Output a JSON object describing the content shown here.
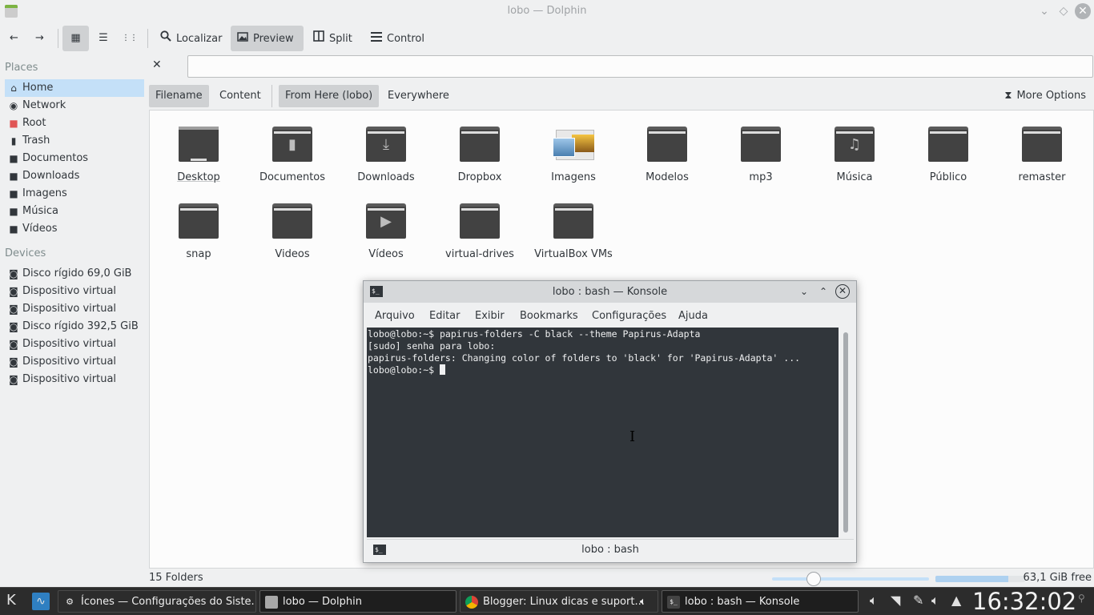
{
  "window": {
    "title": "lobo — Dolphin",
    "controls": {
      "minimize": "⌄",
      "maximize": "◇",
      "close": "✕"
    }
  },
  "toolbar": {
    "back_icon": "←",
    "forward_icon": "→",
    "view_icons": "▦",
    "view_compact": "☰",
    "view_details": "⋮⋮",
    "search_label": "Localizar",
    "preview_label": "Preview",
    "split_label": "Split",
    "control_label": "Control"
  },
  "sidebar": {
    "places_title": "Places",
    "places": [
      {
        "label": "Home",
        "icon": "home-icon"
      },
      {
        "label": "Network",
        "icon": "network-icon"
      },
      {
        "label": "Root",
        "icon": "folder-red-icon"
      },
      {
        "label": "Trash",
        "icon": "trash-icon"
      },
      {
        "label": "Documentos",
        "icon": "folder-icon"
      },
      {
        "label": "Downloads",
        "icon": "folder-icon"
      },
      {
        "label": "Imagens",
        "icon": "folder-icon"
      },
      {
        "label": "Música",
        "icon": "folder-icon"
      },
      {
        "label": "Vídeos",
        "icon": "folder-icon"
      }
    ],
    "devices_title": "Devices",
    "devices": [
      "Disco rígido 69,0 GiB",
      "Dispositivo virtual",
      "Dispositivo virtual",
      "Disco rígido 392,5 GiB",
      "Dispositivo virtual",
      "Dispositivo virtual",
      "Dispositivo virtual"
    ]
  },
  "search": {
    "close_icon": "✕",
    "value": "",
    "filters": {
      "filename": "Filename",
      "content": "Content",
      "from_here": "From Here (lobo)",
      "everywhere": "Everywhere",
      "more_options": "More Options"
    }
  },
  "files": [
    {
      "name": "Desktop",
      "type": "desktop"
    },
    {
      "name": "Documentos",
      "type": "documents"
    },
    {
      "name": "Downloads",
      "type": "downloads"
    },
    {
      "name": "Dropbox",
      "type": "folder"
    },
    {
      "name": "Imagens",
      "type": "images"
    },
    {
      "name": "Modelos",
      "type": "folder"
    },
    {
      "name": "mp3",
      "type": "folder"
    },
    {
      "name": "Música",
      "type": "music"
    },
    {
      "name": "Público",
      "type": "folder"
    },
    {
      "name": "remaster",
      "type": "folder"
    },
    {
      "name": "snap",
      "type": "folder"
    },
    {
      "name": "Videos",
      "type": "folder"
    },
    {
      "name": "Vídeos",
      "type": "videos"
    },
    {
      "name": "virtual-drives",
      "type": "folder"
    },
    {
      "name": "VirtualBox VMs",
      "type": "folder"
    }
  ],
  "konsole": {
    "title": "lobo : bash — Konsole",
    "menu": [
      "Arquivo",
      "Editar",
      "Exibir",
      "Bookmarks",
      "Configurações",
      "Ajuda"
    ],
    "lines": [
      "lobo@lobo:~$ papirus-folders -C black --theme Papirus-Adapta",
      "[sudo] senha para lobo:",
      "papirus-folders: Changing color of folders to 'black' for 'Papirus-Adapta' ...",
      "lobo@lobo:~$ "
    ],
    "tab_label": "lobo : bash"
  },
  "status": {
    "count": "15 Folders",
    "free_space": "63,1 GiB free",
    "used_fraction": 0.81
  },
  "taskbar": {
    "tasks": [
      "Ícones  — Configurações do Siste...",
      "lobo — Dolphin",
      "Blogger: Linux dicas e suport...",
      "lobo : bash — Konsole"
    ],
    "clock": "16:32:02"
  }
}
